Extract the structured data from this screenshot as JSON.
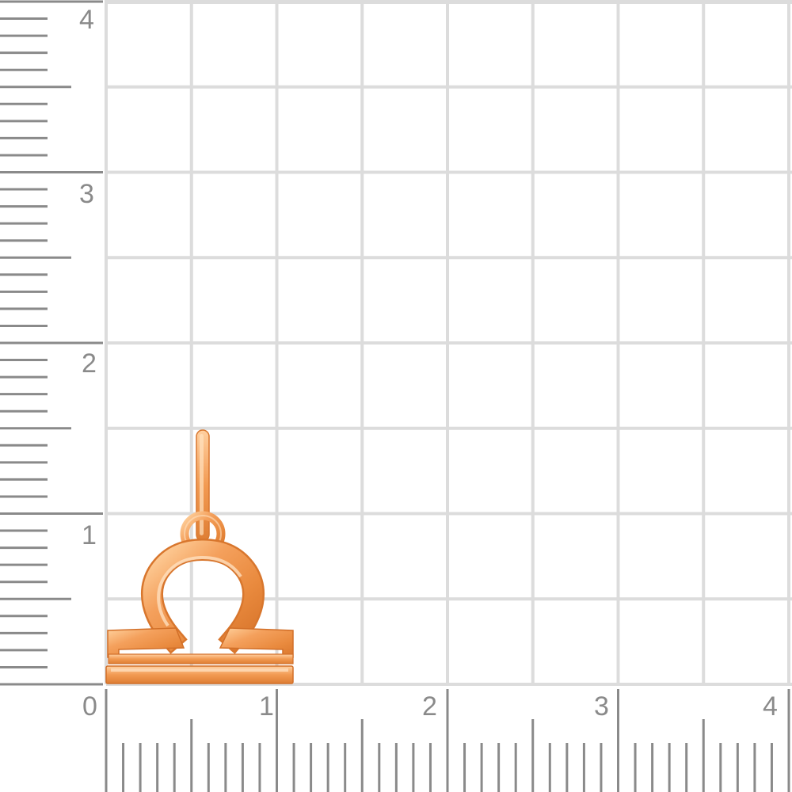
{
  "ruler": {
    "unit_labels_y": [
      "1",
      "2",
      "3",
      "4"
    ],
    "unit_labels_x": [
      "0",
      "1",
      "2",
      "3",
      "4"
    ],
    "grid_color": "#dcdcdc",
    "tick_color": "#8a8a8a"
  },
  "pendant": {
    "subject": "libra-zodiac-pendant",
    "metal_color": "#f0954a"
  }
}
